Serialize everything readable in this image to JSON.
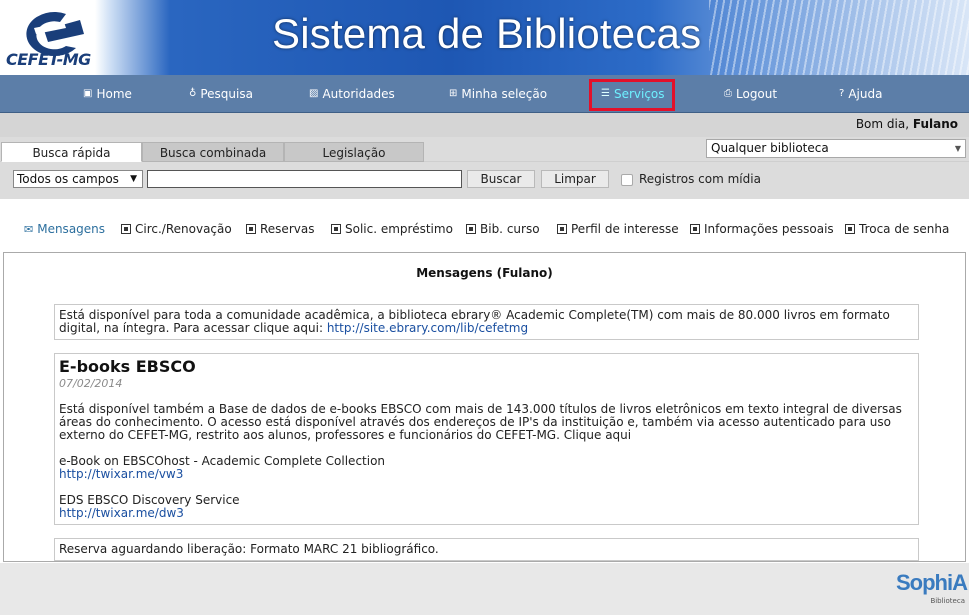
{
  "header": {
    "logo_text": "CEFET-MG",
    "title": "Sistema de Bibliotecas"
  },
  "nav": {
    "items": [
      {
        "label": "Home",
        "icon": "home-icon"
      },
      {
        "label": "Pesquisa",
        "icon": "pin-icon"
      },
      {
        "label": "Autoridades",
        "icon": "person-icon"
      },
      {
        "label": "Minha seleção",
        "icon": "grid-icon"
      },
      {
        "label": "Serviços",
        "icon": "services-icon",
        "active": true
      },
      {
        "label": "Logout",
        "icon": "logout-icon"
      },
      {
        "label": "Ajuda",
        "icon": "help-icon"
      }
    ]
  },
  "greeting": {
    "prefix": "Bom dia,",
    "user": "Fulano"
  },
  "search": {
    "tabs": [
      "Busca rápida",
      "Busca combinada",
      "Legislação"
    ],
    "active_tab": "Busca rápida",
    "library_select": "Qualquer biblioteca",
    "field_select": "Todos os campos",
    "query_value": "",
    "search_button": "Buscar",
    "clear_button": "Limpar",
    "media_checkbox_label": "Registros com mídia",
    "media_checked": false
  },
  "services": {
    "items": [
      {
        "label": "Mensagens",
        "icon": "envelope-icon",
        "active": true
      },
      {
        "label": "Circ./Renovação",
        "icon": "renew-icon"
      },
      {
        "label": "Reservas",
        "icon": "reserve-icon"
      },
      {
        "label": "Solic. empréstimo",
        "icon": "loan-request-icon"
      },
      {
        "label": "Bib. curso",
        "icon": "course-library-icon"
      },
      {
        "label": "Perfil de interesse",
        "icon": "bookmark-icon"
      },
      {
        "label": "Informações pessoais",
        "icon": "user-card-icon"
      },
      {
        "label": "Troca de senha",
        "icon": "password-icon"
      }
    ]
  },
  "messages": {
    "title": "Mensagens (Fulano)",
    "msg1": {
      "text": "Está disponível para toda a comunidade acadêmica, a biblioteca ebrary® Academic Complete(TM) com mais de 80.000 livros em formato digital, na íntegra. Para acessar clique aqui:",
      "link": "http://site.ebrary.com/lib/cefetmg"
    },
    "msg2": {
      "heading": "E-books EBSCO",
      "date": "07/02/2014",
      "body": "Está disponível também a Base de dados de e-books EBSCO com mais de 143.000 títulos de livros eletrônicos em texto integral de diversas áreas do conhecimento. O acesso está disponível através dos endereços de IP's da instituição e, também via acesso autenticado para uso externo do CEFET-MG, restrito aos alunos, professores e funcionários do CEFET-MG. Clique aqui",
      "item1_label": "e-Book on EBSCOhost - Academic Complete Collection",
      "item1_link": "http://twixar.me/vw3",
      "item2_label": "EDS EBSCO Discovery Service",
      "item2_link": "http://twixar.me/dw3"
    },
    "msg3": {
      "text": "Reserva aguardando liberação: Formato MARC 21 bibliográfico."
    }
  },
  "footer": {
    "brand": "SophiA",
    "brand_sub": "Biblioteca"
  }
}
